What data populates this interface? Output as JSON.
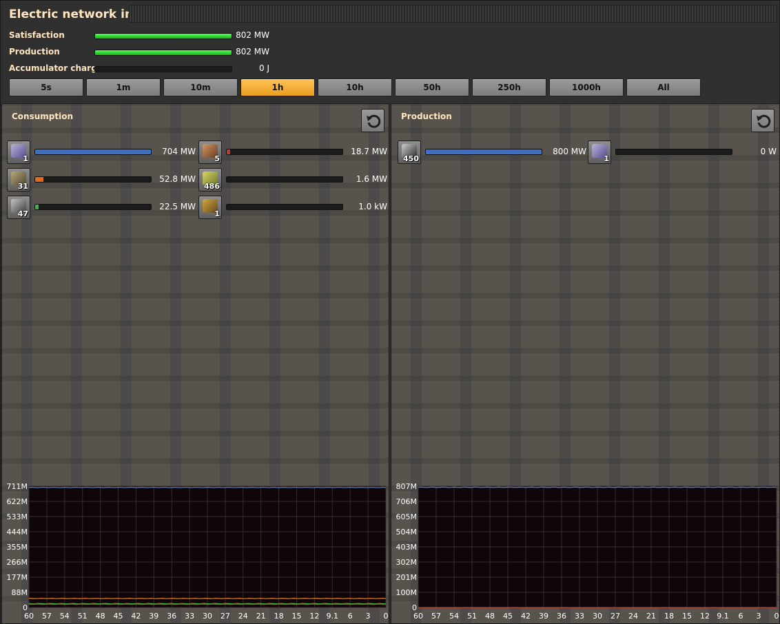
{
  "window": {
    "title": "Electric network info"
  },
  "stats": [
    {
      "label": "Satisfaction",
      "value": "802 MW",
      "fill": 1.0
    },
    {
      "label": "Production",
      "value": "802 MW",
      "fill": 1.0
    },
    {
      "label": "Accumulator charge",
      "value": "0 J",
      "fill": 0.0
    }
  ],
  "timescale": {
    "buttons": [
      "5s",
      "1m",
      "10m",
      "1h",
      "10h",
      "50h",
      "250h",
      "1000h",
      "All"
    ],
    "selected": "1h"
  },
  "consumption": {
    "title": "Consumption",
    "entities": [
      {
        "icon": "beacon-icon",
        "count": "1",
        "value": "704 MW",
        "fill": 1.0,
        "bar_color": "#3f6fc5"
      },
      {
        "icon": "character-icon",
        "count": "5",
        "value": "18.7 MW",
        "fill": 0.03,
        "bar_color": "#c23a2a"
      },
      {
        "icon": "assembling-machine-icon",
        "count": "31",
        "value": "52.8 MW",
        "fill": 0.07,
        "bar_color": "#e06a1c"
      },
      {
        "icon": "inserter-icon",
        "count": "486",
        "value": "1.6 MW",
        "fill": 0.0,
        "bar_color": "#39b34a"
      },
      {
        "icon": "electric-mining-drill-icon",
        "count": "47",
        "value": "22.5 MW",
        "fill": 0.03,
        "bar_color": "#39b34a"
      },
      {
        "icon": "radar-icon",
        "count": "1",
        "value": "1.0 kW",
        "fill": 0.0,
        "bar_color": "#39b34a"
      }
    ]
  },
  "production": {
    "title": "Production",
    "entities": [
      {
        "icon": "steam-engine-icon",
        "count": "450",
        "value": "800 MW",
        "fill": 1.0,
        "bar_color": "#3f6fc5"
      },
      {
        "icon": "beacon-icon",
        "count": "1",
        "value": "0 W",
        "fill": 0.0,
        "bar_color": "#3f6fc5"
      }
    ]
  },
  "chart_data": [
    {
      "type": "line",
      "yticks": [
        "711M",
        "622M",
        "533M",
        "444M",
        "355M",
        "266M",
        "177M",
        "88M",
        "0"
      ],
      "xticks": [
        "60",
        "57",
        "54",
        "51",
        "48",
        "45",
        "42",
        "39",
        "36",
        "33",
        "30",
        "27",
        "24",
        "21",
        "18",
        "15",
        "12",
        "9.1",
        "6",
        "3",
        "0"
      ],
      "ylim": [
        0,
        711
      ],
      "xlim": [
        60,
        0
      ],
      "grid": true,
      "series": [
        {
          "color": "#4a7fd6",
          "level": 704
        },
        {
          "color": "#e06a1c",
          "level": 52.8
        },
        {
          "color": "#39b34a",
          "level": 22.5
        },
        {
          "color": "#c23a2a",
          "level": 18.7
        }
      ]
    },
    {
      "type": "line",
      "yticks": [
        "807M",
        "706M",
        "605M",
        "504M",
        "403M",
        "302M",
        "201M",
        "100M",
        "0"
      ],
      "xticks": [
        "60",
        "57",
        "54",
        "51",
        "48",
        "45",
        "42",
        "39",
        "36",
        "33",
        "30",
        "27",
        "24",
        "21",
        "18",
        "15",
        "12",
        "9.1",
        "6",
        "3",
        "0"
      ],
      "ylim": [
        0,
        807
      ],
      "xlim": [
        60,
        0
      ],
      "grid": true,
      "series": [
        {
          "color": "#4a7fd6",
          "level": 800
        },
        {
          "color": "#c23a2a",
          "level": 0
        }
      ]
    }
  ]
}
